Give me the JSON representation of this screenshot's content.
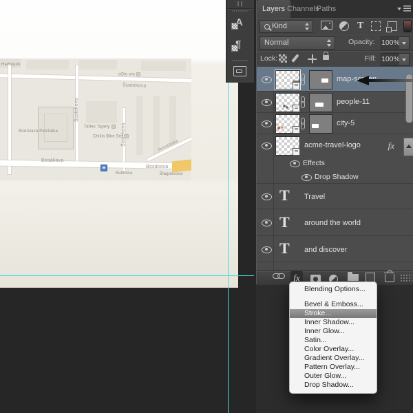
{
  "layers_panel": {
    "tabs": [
      "Layers",
      "Channels",
      "Paths"
    ],
    "filter_row": {
      "kind_label": "Kind"
    },
    "blend_row": {
      "mode": "Normal",
      "opacity_label": "Opacity:",
      "opacity_value": "100%"
    },
    "lock_row": {
      "label": "Lock:",
      "fill_label": "Fill:",
      "fill_value": "100%"
    },
    "layers": [
      {
        "name": "map-screen...",
        "selected": true
      },
      {
        "name": "people-11"
      },
      {
        "name": "city-5"
      },
      {
        "name": "acme-travel-logo",
        "fx_badge": "fx"
      },
      {
        "name": "Effects"
      },
      {
        "name": "Drop Shadow"
      },
      {
        "name": "Travel"
      },
      {
        "name": "around the world"
      },
      {
        "name": "and discover"
      }
    ],
    "type_icon_glyph": "T",
    "bottom_bar": {
      "fx_label": "fx"
    }
  },
  "styles_menu": {
    "items": [
      "Blending Options...",
      "Bevel & Emboss...",
      "Stroke...",
      "Inner Shadow...",
      "Inner Glow...",
      "Satin...",
      "Color Overlay...",
      "Gradient Overlay...",
      "Pattern Overlay...",
      "Outer Glow...",
      "Drop Shadow..."
    ],
    "highlighted": "Stroke..."
  },
  "dock": {
    "char_styles_glyph": "A",
    "para_styles_glyph": "¶"
  },
  "canvas": {
    "map_labels": {
      "road_top": "Šustekova",
      "road_v1": "Šustekova",
      "road_v2": "Šustekova",
      "road_bottom_left": "Bosákova",
      "road_bottom_right": "Bosákova",
      "road_diagonal": "Tematínska",
      "poi_top_left": "Harlequin",
      "poi_top_right": "sOlo sro",
      "poi_mid_1": "Tafles Tapety",
      "poi_mid_2": "Chillis Bike Sro",
      "building_label": "Bratislava Petržalka",
      "street_small_1": "Bulíkova",
      "street_small_2": "Blagoevova"
    }
  },
  "colors": {
    "guide": "#45dcd8",
    "selected_layer_bg": "#68798b",
    "yellow_road": "#f0c868",
    "menu_highlight": "#8a8a8a"
  }
}
